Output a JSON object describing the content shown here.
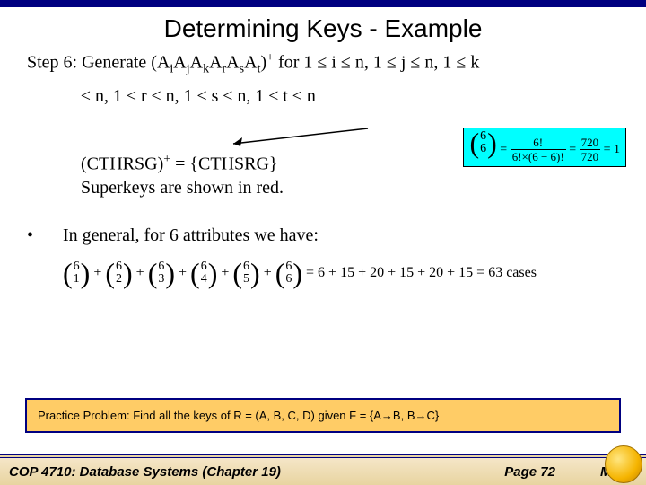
{
  "title": "Determining Keys - Example",
  "step": {
    "label": "Step 6: Generate (A",
    "sub1": "i",
    "a2": "A",
    "sub2": "j",
    "a3": "A",
    "sub3": "k",
    "a4": "A",
    "sub4": "r",
    "a5": "A",
    "sub5": "s",
    "a6": "A",
    "sub6": "t",
    "closeplus": ")",
    "plus": "+",
    "for": " for 1 ≤ i ≤ n, 1 ≤ j ≤ n, 1 ≤ k",
    "line2": "≤ n, 1 ≤ r ≤ n, 1 ≤ s ≤ n, 1 ≤ t ≤ n"
  },
  "formula": {
    "binom_top": "6",
    "binom_bot": "6",
    "eq1": "=",
    "num1": "6!",
    "den1": "6!×(6 − 6)!",
    "eq2": "=",
    "num2": "720",
    "den2": "720",
    "eq3": "= 1"
  },
  "closure": {
    "line1a": "(CTHRSG)",
    "line1sup": "+",
    "line1b": " =  {CTHSRG}",
    "line2": "Superkeys are shown in red."
  },
  "bullet": {
    "dot": "•",
    "text": "In general, for 6 attributes we have:"
  },
  "combo": {
    "tops": [
      "6",
      "6",
      "6",
      "6",
      "6",
      "6"
    ],
    "bots": [
      "1",
      "2",
      "3",
      "4",
      "5",
      "6"
    ],
    "plus": "+",
    "eq": " = 6 + 15 + 20 + 15 + 20 + 15 = 63  cases"
  },
  "practice": "Practice Problem:  Find all the keys of R = (A, B, C, D) given F = {A→B, B→C}",
  "footer": {
    "course": "COP 4710: Database Systems  (Chapter 19)",
    "page": "Page 72",
    "instr": "Mark"
  }
}
